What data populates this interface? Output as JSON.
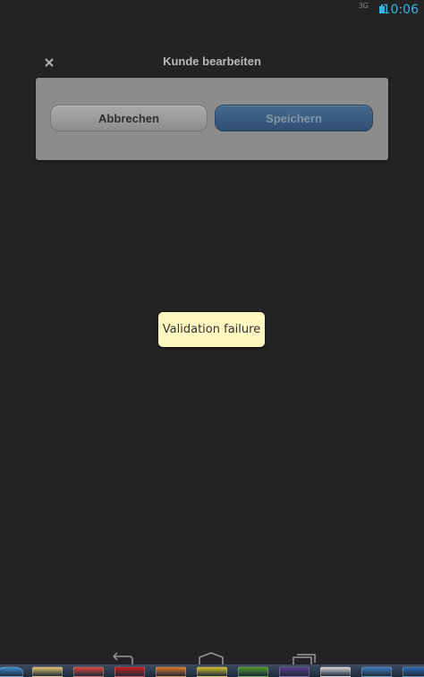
{
  "status_bar": {
    "signal": "3G",
    "time": "10:06",
    "clock_color": "#33b5e5"
  },
  "dialog": {
    "title": "Kunde bearbeiten",
    "close_icon": "close-icon",
    "cancel_label": "Abbrechen",
    "save_label": "Speichern"
  },
  "toast": {
    "message": "Validation failure",
    "background": "#fff7c0"
  },
  "nav_bar": {
    "icons": [
      "back-icon",
      "home-icon",
      "recents-icon"
    ]
  },
  "taskbar": {
    "icons": [
      {
        "name": "start-orb-icon",
        "color": "#3e8ed0"
      },
      {
        "name": "file-explorer-icon",
        "color": "#e3c46b"
      },
      {
        "name": "chrome-icon",
        "color": "#d9463a"
      },
      {
        "name": "opera-icon",
        "color": "#cc1b1b"
      },
      {
        "name": "firefox-icon",
        "color": "#e07a22"
      },
      {
        "name": "app-yellow-icon",
        "color": "#d9c22a"
      },
      {
        "name": "app-green-icon",
        "color": "#4c9a2a"
      },
      {
        "name": "eclipse-icon",
        "color": "#5a3d8e"
      },
      {
        "name": "notepad-icon",
        "color": "#d8d8d8"
      },
      {
        "name": "remote-desktop-icon",
        "color": "#3f7fc1"
      },
      {
        "name": "editor-icon",
        "color": "#2b6fb6"
      }
    ]
  }
}
